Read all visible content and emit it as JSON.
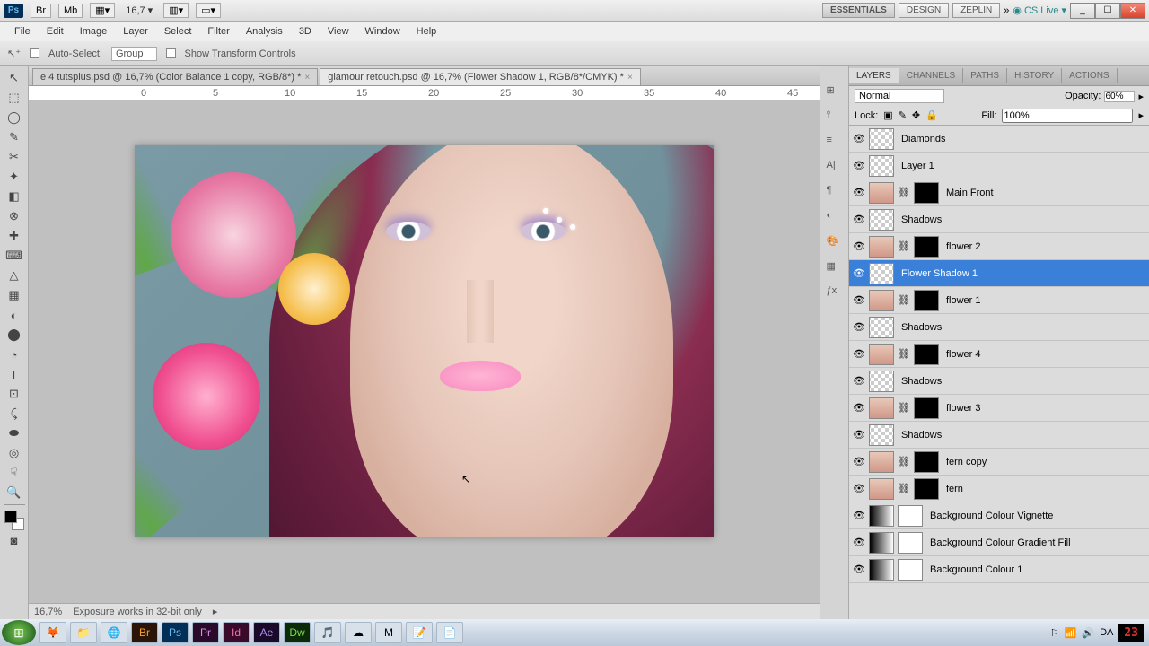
{
  "topbar": {
    "app": "Ps",
    "zoom": "16,7",
    "workspaces": [
      "ESSENTIALS",
      "DESIGN",
      "ZEPLIN"
    ],
    "active_workspace": 0,
    "chevron": "»",
    "cslive": "CS Live"
  },
  "menu": [
    "File",
    "Edit",
    "Image",
    "Layer",
    "Select",
    "Filter",
    "Analysis",
    "3D",
    "View",
    "Window",
    "Help"
  ],
  "options": {
    "autosel_label": "Auto-Select:",
    "autosel_value": "Group",
    "show_transform": "Show Transform Controls"
  },
  "doc_tabs": [
    {
      "label": "e 4 tutsplus.psd @ 16,7% (Color Balance 1 copy, RGB/8*) *",
      "active": false
    },
    {
      "label": "glamour retouch.psd @ 16,7% (Flower Shadow 1, RGB/8*/CMYK) *",
      "active": true
    }
  ],
  "ruler_marks": [
    "0",
    "5",
    "10",
    "15",
    "20",
    "25",
    "30",
    "35",
    "40",
    "45"
  ],
  "layers_panel": {
    "tabs": [
      "LAYERS",
      "CHANNELS",
      "PATHS",
      "HISTORY",
      "ACTIONS"
    ],
    "active_tab": 0,
    "blend": "Normal",
    "opacity_label": "Opacity:",
    "opacity": "60%",
    "lock_label": "Lock:",
    "fill_label": "Fill:",
    "fill": "100%",
    "layers": [
      {
        "name": "Diamonds",
        "type": "plain",
        "selected": false
      },
      {
        "name": "Layer 1",
        "type": "plain",
        "selected": false
      },
      {
        "name": "Main Front",
        "type": "masked",
        "selected": false
      },
      {
        "name": "Shadows",
        "type": "plain",
        "selected": false
      },
      {
        "name": "flower 2",
        "type": "masked",
        "selected": false
      },
      {
        "name": "Flower Shadow 1",
        "type": "plain",
        "selected": true
      },
      {
        "name": "flower 1",
        "type": "masked",
        "selected": false
      },
      {
        "name": "Shadows",
        "type": "plain",
        "selected": false
      },
      {
        "name": "flower 4",
        "type": "masked",
        "selected": false
      },
      {
        "name": "Shadows",
        "type": "plain",
        "selected": false
      },
      {
        "name": "flower 3",
        "type": "masked",
        "selected": false
      },
      {
        "name": "Shadows",
        "type": "plain",
        "selected": false
      },
      {
        "name": "fern copy",
        "type": "masked",
        "selected": false
      },
      {
        "name": "fern",
        "type": "masked",
        "selected": false
      },
      {
        "name": "Background Colour Vignette",
        "type": "adj",
        "selected": false
      },
      {
        "name": "Background Colour Gradient Fill",
        "type": "adj",
        "selected": false
      },
      {
        "name": "Background Colour 1",
        "type": "adj",
        "selected": false
      }
    ]
  },
  "status": {
    "zoom": "16,7%",
    "msg": "Exposure works in 32-bit only"
  },
  "taskbar_icons": [
    "ff",
    "📁",
    "🌐",
    "Br",
    "Ps",
    "Pr",
    "Id",
    "Ae",
    "Dw",
    "🎵",
    "☁",
    "◎",
    "M",
    "📝",
    "📄"
  ],
  "tray": {
    "time": "23"
  },
  "tool_glyphs": [
    "↖",
    "⬚",
    "◯",
    "✎",
    "✂",
    "✦",
    "◧",
    "⊗",
    "✚",
    "⌨",
    "△",
    "▦",
    "◐",
    "⬤",
    "◔",
    "◑",
    "⊡",
    "⤹",
    "⟋",
    "T",
    "↗",
    "⁄",
    "☟",
    "Q",
    "⊞"
  ]
}
